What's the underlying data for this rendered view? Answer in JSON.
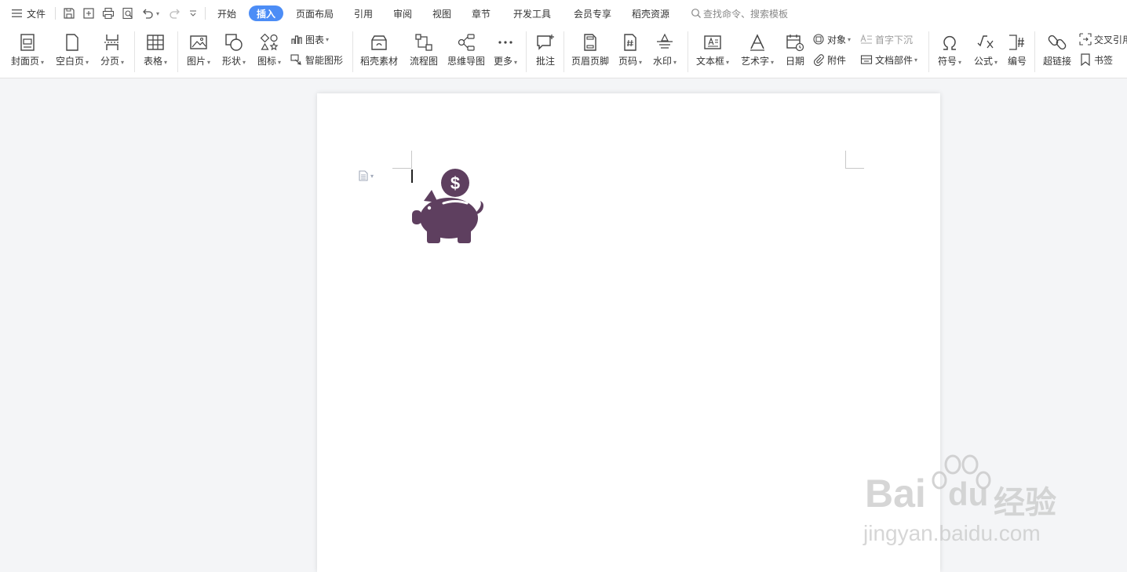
{
  "menubar": {
    "file_label": "文件",
    "tabs": [
      "开始",
      "插入",
      "页面布局",
      "引用",
      "审阅",
      "视图",
      "章节",
      "开发工具",
      "会员专享",
      "稻壳资源"
    ],
    "active_tab": "插入",
    "search_placeholder": "查找命令、搜索模板"
  },
  "ribbon": {
    "cover": "封面页",
    "blank": "空白页",
    "pagebreak": "分页",
    "table": "表格",
    "picture": "图片",
    "shape": "形状",
    "icon": "图标",
    "chart": "图表",
    "smartart": "智能图形",
    "docer": "稻壳素材",
    "flowchart": "流程图",
    "mindmap": "思维导图",
    "more": "更多",
    "comment": "批注",
    "headerfooter": "页眉页脚",
    "pagenum": "页码",
    "watermark": "水印",
    "textbox": "文本框",
    "wordart": "艺术字",
    "date": "日期",
    "object": "对象",
    "attachment": "附件",
    "dropcap": "首字下沉",
    "docparts": "文档部件",
    "symbol": "符号",
    "formula": "公式",
    "numbering": "编号",
    "hyperlink": "超链接",
    "crossref": "交叉引用",
    "bookmark": "书签"
  },
  "colors": {
    "accent": "#4c8df6",
    "piggy": "#5e3f5f",
    "canvas": "#f4f5f7"
  },
  "watermark": {
    "brand": "Bai",
    "brand2": "du",
    "cn": "经验",
    "url": "jingyan.baidu.com"
  }
}
